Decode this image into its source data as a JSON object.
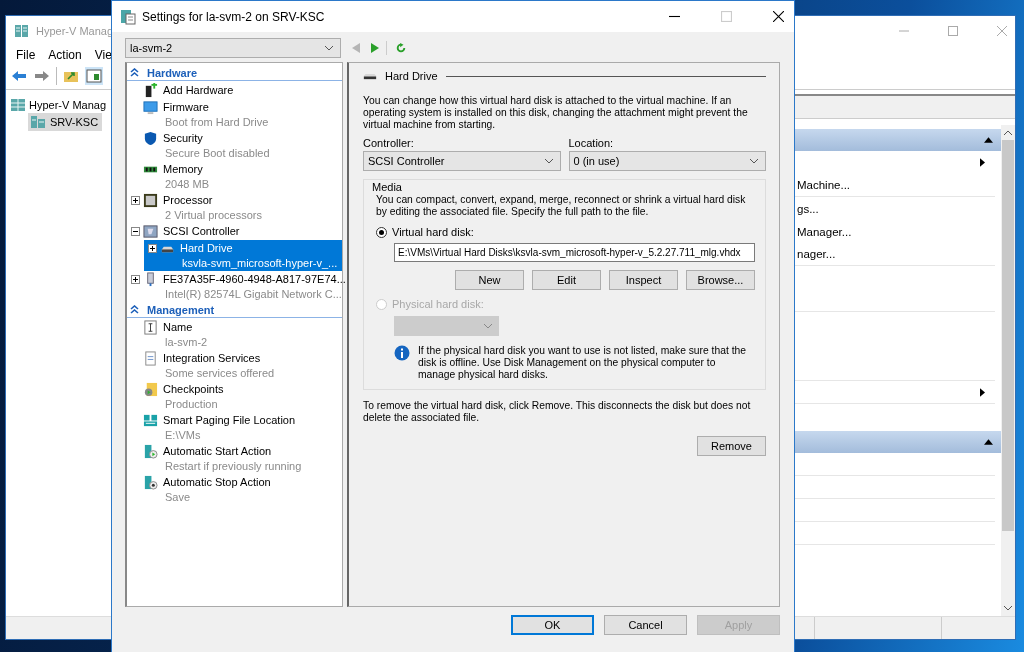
{
  "background_window": {
    "title": "Hyper-V Manag",
    "menu": [
      "File",
      "Action",
      "Vie"
    ],
    "tree": [
      {
        "label": "Hyper-V Manag",
        "selected": false,
        "children": [
          {
            "label": "SRV-KSC",
            "selected": true
          }
        ]
      }
    ],
    "actions": [
      {
        "expanded": true,
        "items": [
          {
            "submenu": true,
            "separator": false
          },
          {
            "label": "Machine...",
            "submenu": false,
            "separator": true
          },
          {
            "label": "gs...",
            "submenu": false,
            "separator": false
          },
          {
            "label": "Manager...",
            "submenu": false,
            "separator": false
          },
          {
            "label": "nager...",
            "submenu": false,
            "separator": true
          },
          {
            "submenu": false,
            "separator": false
          },
          {
            "submenu": false,
            "separator": true
          },
          {
            "submenu": false,
            "separator": false
          },
          {
            "submenu": false,
            "separator": false
          },
          {
            "submenu": false,
            "separator": true
          },
          {
            "submenu": true,
            "separator": true
          },
          {
            "submenu": false,
            "separator": false
          }
        ]
      },
      {
        "expanded": true,
        "items": [
          {
            "submenu": false,
            "separator": true
          },
          {
            "submenu": false,
            "separator": true
          },
          {
            "submenu": false,
            "separator": true
          },
          {
            "submenu": false,
            "separator": true
          }
        ]
      }
    ]
  },
  "dialog": {
    "title": "Settings for la-svm-2 on SRV-KSC",
    "vm": "la-svm-2",
    "nav": [
      {
        "kind": "back",
        "disabled": true
      },
      {
        "kind": "forward",
        "disabled": false
      },
      {
        "kind": "refresh",
        "disabled": false
      }
    ],
    "tree": [
      {
        "title": "Hardware",
        "expanded": true,
        "items": [
          {
            "kind": "add",
            "name": "Add Hardware",
            "selected": false
          },
          {
            "kind": "firmware",
            "name": "Firmware",
            "detail": "Boot from Hard Drive",
            "selected": false
          },
          {
            "kind": "shield",
            "name": "Security",
            "detail": "Secure Boot disabled",
            "selected": false
          },
          {
            "kind": "memory",
            "name": "Memory",
            "detail": "2048 MB",
            "selected": false
          },
          {
            "kind": "chip",
            "name": "Processor",
            "detail": "2 Virtual processors",
            "selected": false,
            "expanded": false
          },
          {
            "kind": "controller",
            "name": "SCSI Controller",
            "selected": false,
            "expanded": true,
            "children": [
              {
                "kind": "drive",
                "name": "Hard Drive",
                "detail": "ksvla-svm_microsoft-hyper-v_...",
                "selected": true,
                "expanded": false
              }
            ]
          },
          {
            "kind": "adapter",
            "name": "FE37A35F-4960-4948-A817-97E74...",
            "detail": "Intel(R) 82574L Gigabit Network C...",
            "selected": false,
            "expanded": false
          }
        ]
      },
      {
        "title": "Management",
        "expanded": true,
        "items": [
          {
            "kind": "label",
            "name": "Name",
            "detail": "la-svm-2",
            "selected": false
          },
          {
            "kind": "document",
            "name": "Integration Services",
            "detail": "Some services offered",
            "selected": false
          },
          {
            "kind": "checkpoint",
            "name": "Checkpoints",
            "detail": "Production",
            "selected": false
          },
          {
            "kind": "paging",
            "name": "Smart Paging File Location",
            "detail": "E:\\VMs",
            "selected": false
          },
          {
            "kind": "start",
            "name": "Automatic Start Action",
            "detail": "Restart if previously running",
            "selected": false
          },
          {
            "kind": "stop",
            "name": "Automatic Stop Action",
            "detail": "Save",
            "selected": false
          }
        ]
      }
    ],
    "panel": {
      "heading": "Hard Drive",
      "intro": "You can change how this virtual hard disk is attached to the virtual machine. If an operating system is installed on this disk, changing the attachment might prevent the virtual machine from starting.",
      "controller": {
        "label": "Controller:",
        "value": "SCSI Controller"
      },
      "location": {
        "label": "Location:",
        "value": "0 (in use)"
      },
      "media": {
        "legend": "Media",
        "text": "You can compact, convert, expand, merge, reconnect or shrink a virtual hard disk by editing the associated file. Specify the full path to the file.",
        "options": [
          {
            "label": "Virtual hard disk:",
            "selected": true,
            "disabled": false
          },
          {
            "label": "Physical hard disk:",
            "selected": false,
            "disabled": true
          }
        ],
        "path": "E:\\VMs\\Virtual Hard Disks\\ksvla-svm_microsoft-hyper-v_5.2.27.711_mlg.vhdx",
        "buttons": [
          "New",
          "Edit",
          "Inspect",
          "Browse..."
        ],
        "info": "If the physical hard disk you want to use is not listed, make sure that the disk is offline. Use Disk Management on the physical computer to manage physical hard disks."
      },
      "remove_text": "To remove the virtual hard disk, click Remove. This disconnects the disk but does not delete the associated file.",
      "remove_button": "Remove"
    },
    "buttons": [
      {
        "label": "OK",
        "default": true,
        "disabled": false
      },
      {
        "label": "Cancel",
        "default": false,
        "disabled": false
      },
      {
        "label": "Apply",
        "default": false,
        "disabled": true
      }
    ]
  }
}
